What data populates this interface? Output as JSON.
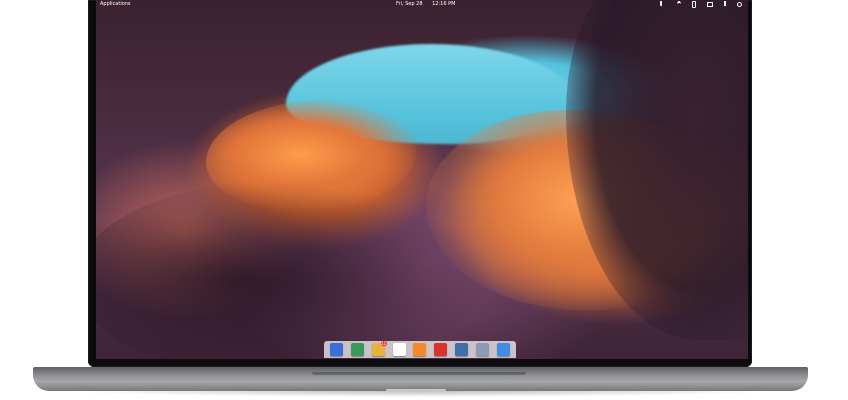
{
  "panel": {
    "applications_label": "Applications",
    "date": "Fri, Sep 28",
    "time": "12:16 PM",
    "indicators": [
      "sound-icon",
      "wifi-icon",
      "bluetooth-icon",
      "mail-icon",
      "battery-icon",
      "power-icon"
    ]
  },
  "dock": {
    "items": [
      {
        "name": "multitasking-view",
        "color": "#3b6fd8"
      },
      {
        "name": "web-browser",
        "color": "#3a9a5b"
      },
      {
        "name": "mail",
        "color": "#e8b23c",
        "badge": "11"
      },
      {
        "name": "calendar",
        "color": "#ffffff"
      },
      {
        "name": "music",
        "color": "#f28a2c"
      },
      {
        "name": "videos",
        "color": "#d9312d"
      },
      {
        "name": "photos",
        "color": "#3e6fa8"
      },
      {
        "name": "system-settings",
        "color": "#8a9cb5"
      },
      {
        "name": "app-center",
        "color": "#3f8ce0"
      }
    ]
  },
  "colors": {
    "sky": "#56c3dc",
    "sandstone_orange": "#e37c3f",
    "rock_purple": "#4a2c3f",
    "dock_bg": "#efeced",
    "bezel": "#0b0b0d",
    "chassis": "#8e8f92"
  }
}
